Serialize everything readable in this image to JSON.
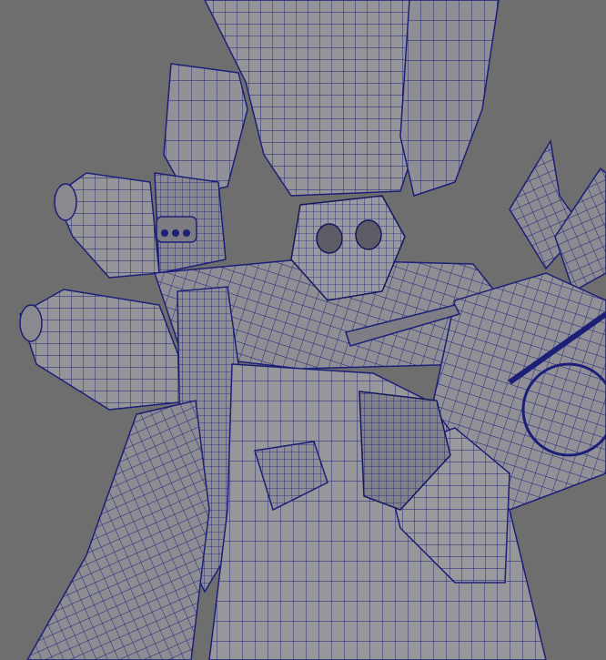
{
  "viewport": {
    "background": "#6e6e6e",
    "shaded_fill": "#959499",
    "shaded_fill_dark": "#86858b",
    "wire_color": "#1c1f78",
    "wire_color_dense": "#14165c"
  }
}
